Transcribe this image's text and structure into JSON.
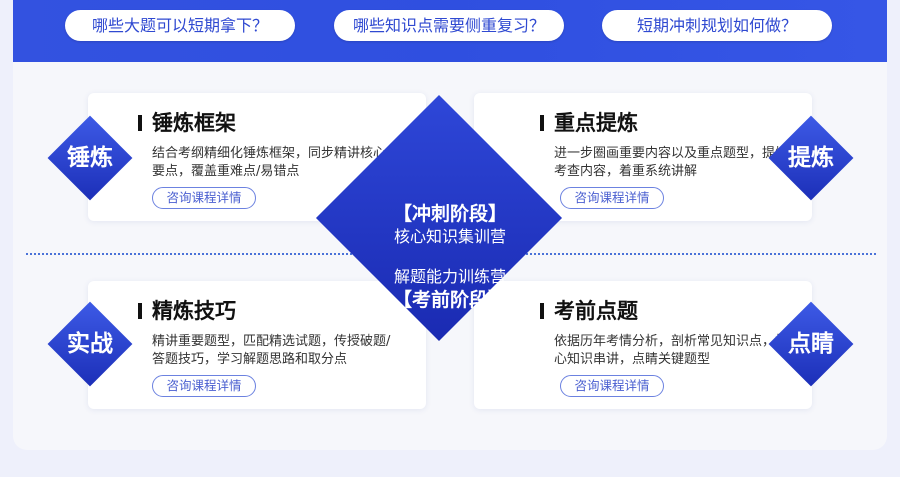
{
  "questions": [
    "哪些大题可以短期拿下？",
    "哪些知识点需要侧重复习？",
    "短期冲刺规划如何做？"
  ],
  "center": {
    "stage1_title": "【冲刺阶段】",
    "stage1_sub": "核心知识集训营",
    "stage2_sub": "解题能力训练营",
    "stage2_title": "【考前阶段】"
  },
  "cards": [
    {
      "badge": "锤炼",
      "title": "锤炼框架",
      "desc": "结合考纲精细化锤炼框架，同步精讲核心要点，覆盖重难点/易错点",
      "button": "咨询课程详情"
    },
    {
      "badge": "提炼",
      "title": "重点提炼",
      "desc": "进一步圈画重要内容以及重点题型，提炼考查内容，着重系统讲解",
      "button": "咨询课程详情"
    },
    {
      "badge": "实战",
      "title": "精炼技巧",
      "desc": "精讲重要题型，匹配精选试题，传授破题/答题技巧，学习解题思路和取分点",
      "button": "咨询课程详情"
    },
    {
      "badge": "点睛",
      "title": "考前点题",
      "desc": "依据历年考情分析，剖析常见知识点，核心知识串讲，点睛关键题型",
      "button": "咨询课程详情"
    }
  ],
  "colors": {
    "accent": "#2f4fe0",
    "diamond_dark": "#1c2fb8",
    "button_border": "#6c82e0"
  }
}
